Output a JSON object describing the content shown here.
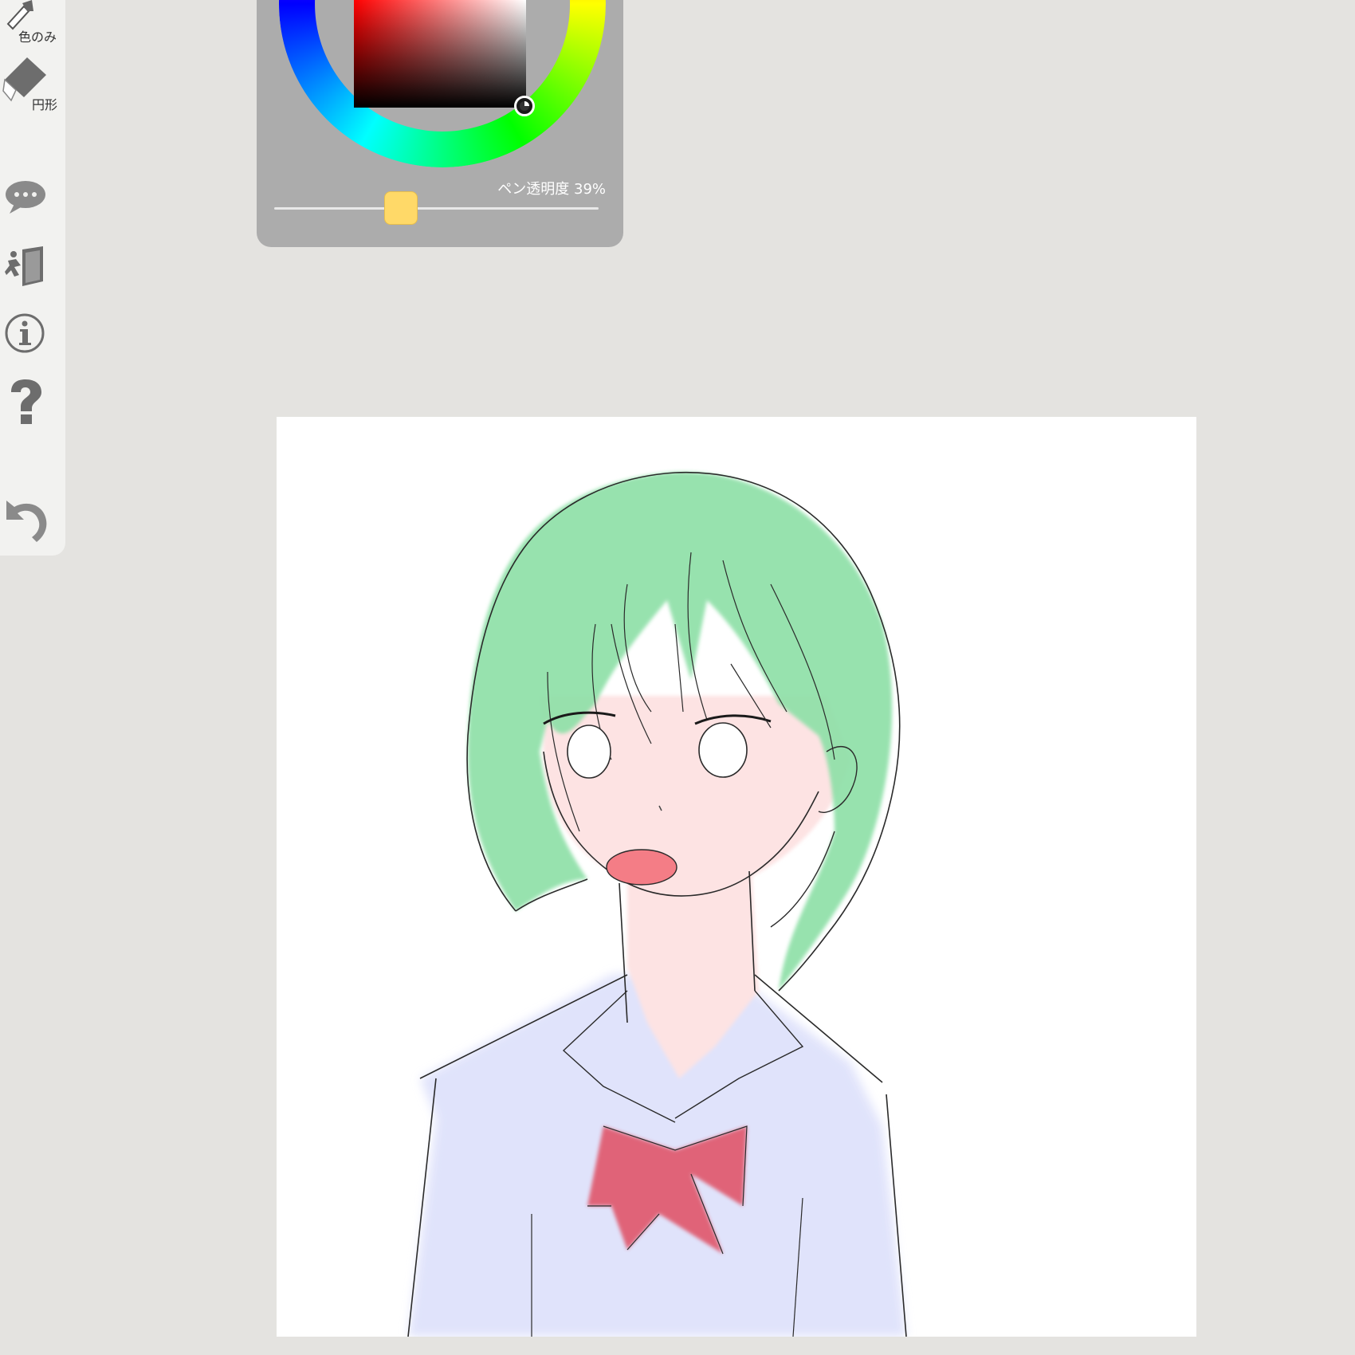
{
  "toolbar": {
    "tools": [
      {
        "name": "eyedropper-color-only",
        "label": "色のみ",
        "icon": "eyedropper-icon"
      },
      {
        "name": "eraser-circle",
        "label": "円形",
        "icon": "eraser-icon"
      },
      {
        "name": "chat",
        "icon": "chat-bubble-icon"
      },
      {
        "name": "exit",
        "icon": "exit-door-icon"
      },
      {
        "name": "info",
        "icon": "info-icon"
      },
      {
        "name": "help",
        "icon": "question-mark-icon"
      },
      {
        "name": "undo",
        "icon": "undo-arrow-icon"
      }
    ]
  },
  "color_picker": {
    "current_color": "#000000",
    "hue_color": "#ff0000",
    "opacity_label": "ペン透明度 39%",
    "opacity_percent": 39
  },
  "canvas": {
    "background": "#ffffff",
    "artwork": "anime-girl-green-hair-sailor-uniform",
    "hair_color": "#8fe0a8",
    "skin_color": "#fde4e2",
    "uniform_color": "#e4e6fb",
    "bow_color": "#e0566b",
    "line_color": "#2a2a2a"
  }
}
